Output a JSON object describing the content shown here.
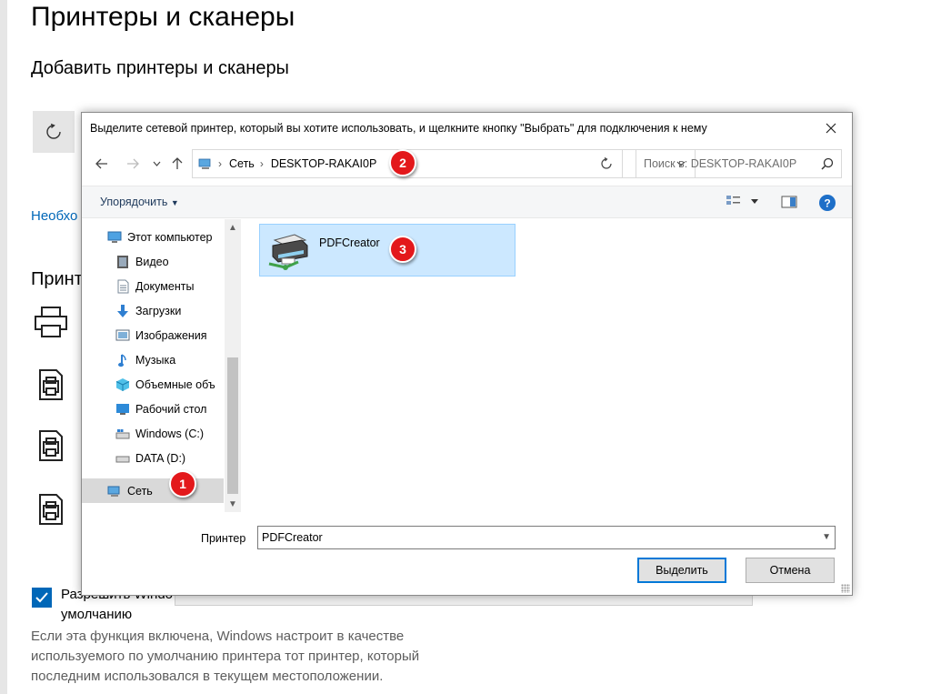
{
  "settings": {
    "page_title": "Принтеры и сканеры",
    "add_section_title": "Добавить принтеры и сканеры",
    "link_partial": "Необхо",
    "printers_section_partial": "Принт",
    "checkbox_label_line1": "Разрешить Windo",
    "checkbox_label_line2": "умолчанию",
    "checkbox_checked": true,
    "description": "Если эта функция включена, Windows настроит в качестве используемого по умолчанию принтера тот принтер, который последним использовался в текущем местоположении."
  },
  "dialog": {
    "title": "Выделите сетевой принтер, который вы хотите использовать, и щелкните кнопку \"Выбрать\" для подключения к нему",
    "address": {
      "segments": [
        "Сеть",
        "DESKTOP-RAKAI0P"
      ]
    },
    "search_placeholder": "Поиск в: DESKTOP-RAKAI0P",
    "organize_label": "Упорядочить",
    "nav_items": [
      {
        "label": "Этот компьютер",
        "icon": "computer-icon"
      },
      {
        "label": "Видео",
        "icon": "video-icon"
      },
      {
        "label": "Документы",
        "icon": "documents-icon"
      },
      {
        "label": "Загрузки",
        "icon": "downloads-icon"
      },
      {
        "label": "Изображения",
        "icon": "pictures-icon"
      },
      {
        "label": "Музыка",
        "icon": "music-icon"
      },
      {
        "label": "Объемные объ",
        "icon": "3d-objects-icon"
      },
      {
        "label": "Рабочий стол",
        "icon": "desktop-icon"
      },
      {
        "label": "Windows (C:)",
        "icon": "drive-c-icon"
      },
      {
        "label": "DATA (D:)",
        "icon": "drive-d-icon"
      },
      {
        "label": "Сеть",
        "icon": "network-icon",
        "selected": true
      }
    ],
    "files": [
      {
        "name": "PDFCreator",
        "icon": "network-printer-icon",
        "selected": true
      }
    ],
    "printer_label": "Принтер",
    "printer_value": "PDFCreator",
    "select_button": "Выделить",
    "cancel_button": "Отмена"
  },
  "annotations": [
    {
      "number": "1",
      "target": "Сеть"
    },
    {
      "number": "2",
      "target": "DESKTOP-RAKAI0P"
    },
    {
      "number": "3",
      "target": "PDFCreator"
    }
  ],
  "colors": {
    "accent": "#0067b8",
    "selection_fill": "#cce8ff",
    "badge_red": "#e3181b"
  }
}
